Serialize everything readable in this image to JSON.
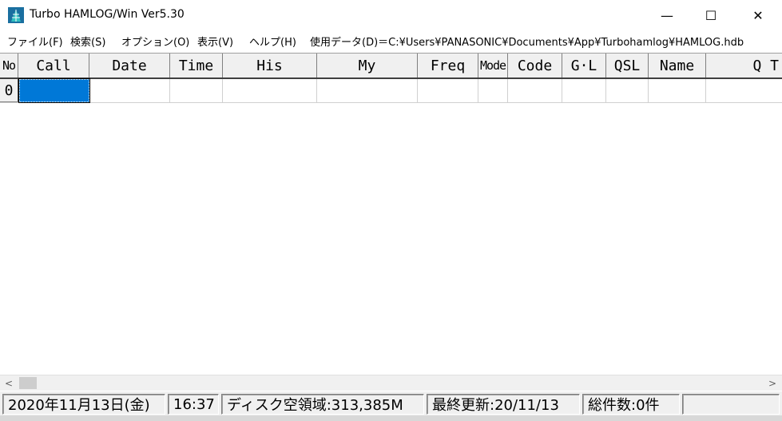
{
  "window": {
    "title": "Turbo HAMLOG/Win Ver5.30",
    "minimize_glyph": "—",
    "maximize_glyph": "☐",
    "close_glyph": "✕"
  },
  "menu": {
    "items": [
      "ファイル(F)",
      "検索(S)",
      "オプション(O)",
      "表示(V)",
      "ヘルプ(H)"
    ],
    "data_path": "使用データ(D)＝C:¥Users¥PANASONIC¥Documents¥App¥Turbohamlog¥HAMLOG.hdb"
  },
  "grid": {
    "columns": [
      "No",
      "Call",
      "Date",
      "Time",
      "His",
      "My",
      "Freq",
      "Mode",
      "Code",
      "G·L",
      "QSL",
      "Name",
      "Q T"
    ],
    "rows": [
      {
        "number": "0"
      }
    ]
  },
  "scrollbar": {
    "left_arrow": "<",
    "right_arrow": ">"
  },
  "status": {
    "date": "2020年11月13日(金)",
    "time": "16:37",
    "disk_space": "ディスク空領域:313,385M",
    "last_updated": "最終更新:20/11/13",
    "total_count": "総件数:0件"
  },
  "colors": {
    "selection": "#0078d7",
    "header_bg": "#f0f0f0"
  }
}
